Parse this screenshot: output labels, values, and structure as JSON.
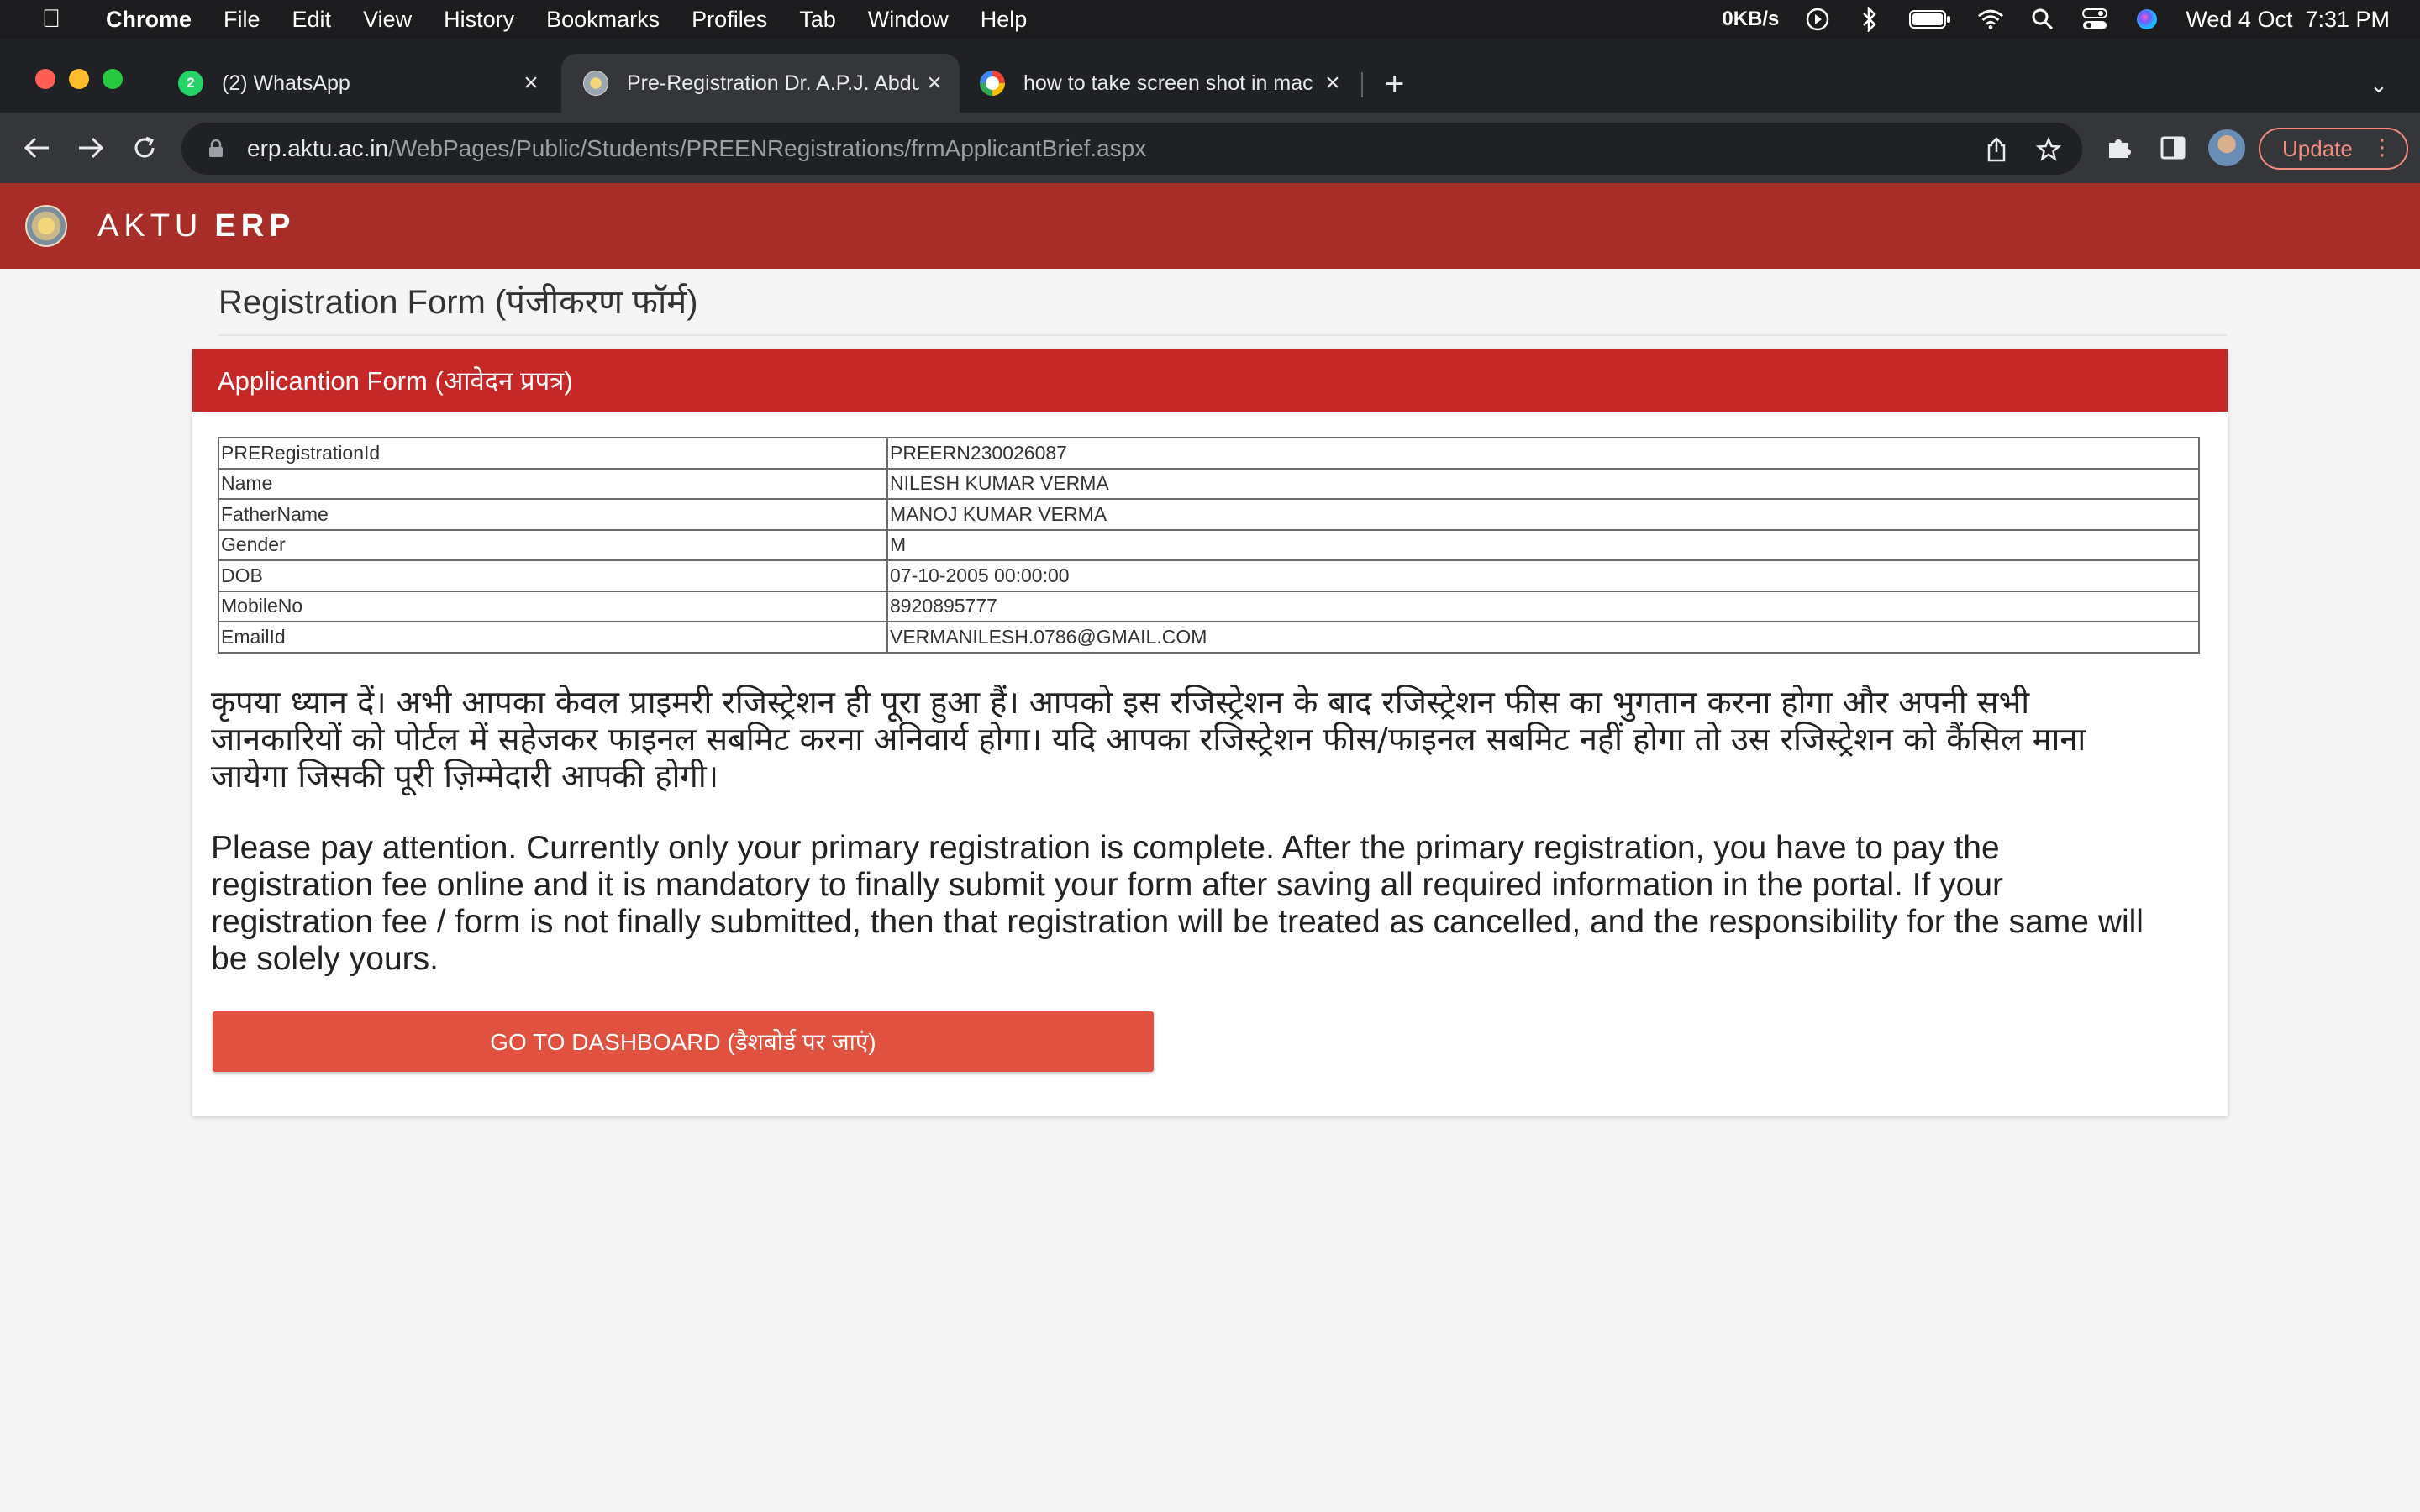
{
  "menubar": {
    "app": "Chrome",
    "items": [
      "File",
      "Edit",
      "View",
      "History",
      "Bookmarks",
      "Profiles",
      "Tab",
      "Window",
      "Help"
    ],
    "net_speed": "0KB/s",
    "datetime": "Wed 4 Oct  7:31 PM"
  },
  "tabs": [
    {
      "title": "(2) WhatsApp",
      "badge": "2",
      "icon": "whatsapp-icon"
    },
    {
      "title": "Pre-Registration Dr. A.P.J. Abdul",
      "icon": "aktu-logo-icon"
    },
    {
      "title": "how to take screen shot in mac",
      "icon": "google-icon"
    }
  ],
  "toolbar": {
    "url_host": "erp.aktu.ac.in",
    "url_path": "/WebPages/Public/Students/PREENRegistrations/frmApplicantBrief.aspx",
    "update_label": "Update"
  },
  "app": {
    "brand": "AKTU",
    "brand_bold": "ERP"
  },
  "page": {
    "title": "Registration Form (पंजीकरण फॉर्म)",
    "card_title": "Applicantion Form (आवेदन प्रपत्र)",
    "rows": [
      {
        "key": "PRERegistrationId",
        "value": "PREERN230026087"
      },
      {
        "key": "Name",
        "value": "NILESH KUMAR VERMA"
      },
      {
        "key": "FatherName",
        "value": "MANOJ KUMAR VERMA"
      },
      {
        "key": "Gender",
        "value": "M"
      },
      {
        "key": "DOB",
        "value": "07-10-2005 00:00:00"
      },
      {
        "key": "MobileNo",
        "value": "8920895777"
      },
      {
        "key": "EmailId",
        "value": "VERMANILESH.0786@GMAIL.COM"
      }
    ],
    "notice_hindi": "कृपया ध्यान दें। अभी आपका केवल प्राइमरी रजिस्ट्रेशन ही पूरा हुआ हैं। आपको इस रजिस्ट्रेशन के बाद रजिस्ट्रेशन फीस का भुगतान करना होगा और अपनी सभी जानकारियों को पोर्टल में सहेजकर फाइनल सबमिट करना अनिवार्य होगा। यदि आपका रजिस्ट्रेशन फीस/फाइनल सबमिट नहीं होगा तो उस रजिस्ट्रेशन को कैंसिल माना जायेगा जिसकी पूरी ज़िम्मेदारी आपकी होगी।",
    "notice_english": "Please pay attention. Currently only your primary registration is complete. After the primary registration, you have to pay the registration fee online and it is mandatory to finally submit your form after saving all required information in the portal. If your registration fee / form is not finally submitted, then that registration will be treated as cancelled, and the responsibility for the same will be solely yours.",
    "dashboard_button": "GO TO DASHBOARD (डैशबोर्ड पर जाएं)"
  },
  "colors": {
    "header_red": "#a82c28",
    "card_head_red": "#c62828",
    "button_red": "#e0523f"
  }
}
